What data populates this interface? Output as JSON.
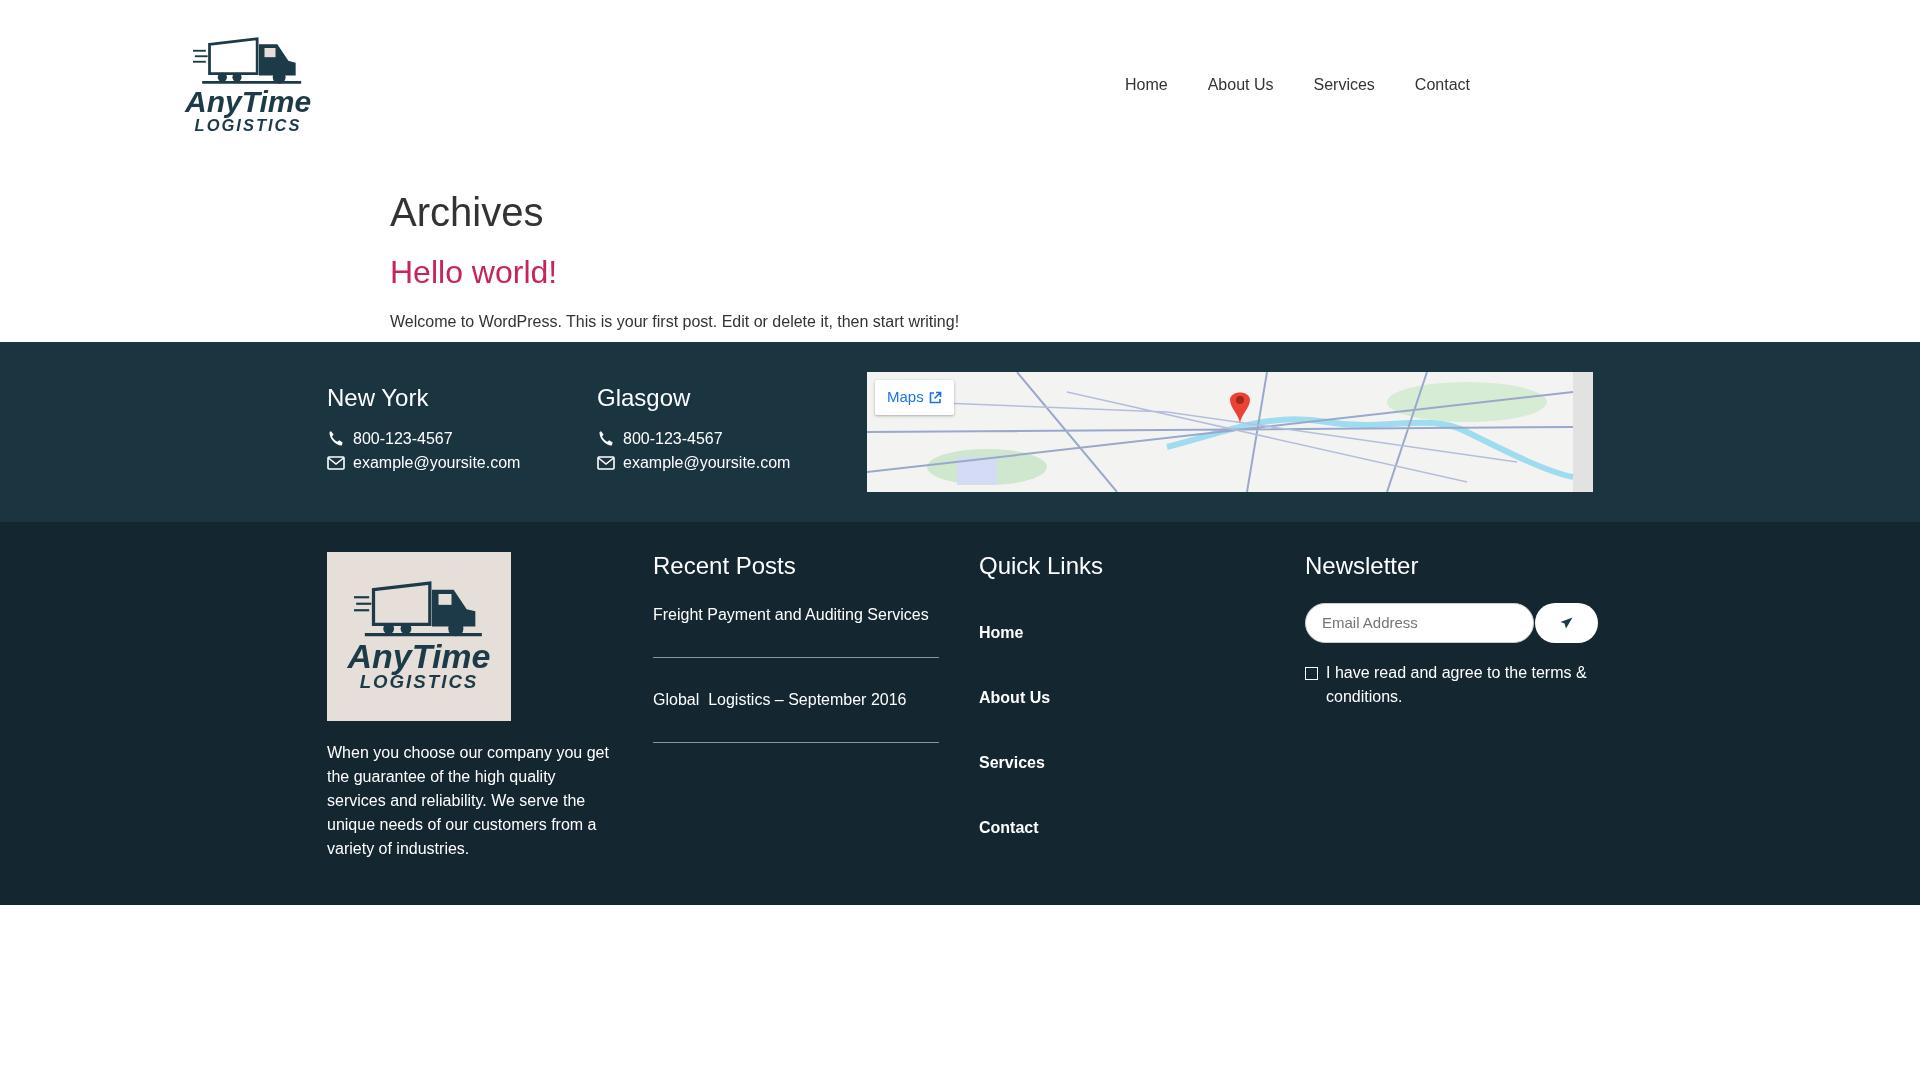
{
  "header": {
    "logo": {
      "brand": "AnyTime",
      "tagline": "LOGISTICS"
    },
    "nav": [
      {
        "label": "Home"
      },
      {
        "label": "About Us"
      },
      {
        "label": "Services"
      },
      {
        "label": "Contact"
      }
    ]
  },
  "main": {
    "title": "Archives",
    "posts": [
      {
        "title": "Hello world!",
        "excerpt": "Welcome to WordPress. This is your first post. Edit or delete it, then start writing!"
      }
    ]
  },
  "locations": [
    {
      "city": "New York",
      "phone": "800-123-4567",
      "email": "example@yoursite.com"
    },
    {
      "city": "Glasgow",
      "phone": "800-123-4567",
      "email": "example@yoursite.com"
    }
  ],
  "map": {
    "kind": "picture",
    "button": "Maps"
  },
  "footer": {
    "logo": {
      "brand": "AnyTime",
      "tagline": "LOGISTICS"
    },
    "about": "When you choose our company you get the guarantee of the high quality services and reliability. We serve the unique needs of our customers from a variety of industries.",
    "recent_posts": {
      "title": "Recent Posts",
      "items": [
        "Freight Payment and Auditing Services",
        "Global  Logistics – September 2016"
      ]
    },
    "quick_links": {
      "title": "Quick Links",
      "items": [
        "Home",
        "About Us",
        "Services",
        "Contact"
      ]
    },
    "newsletter": {
      "title": "Newsletter",
      "placeholder": "Email Address",
      "consent": {
        "label": "I have read and agree to the terms & conditions.",
        "checked": false
      }
    }
  }
}
